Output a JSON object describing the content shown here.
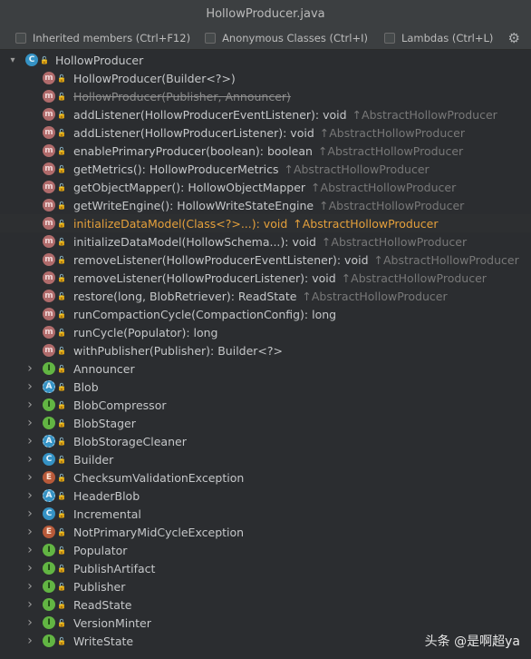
{
  "window": {
    "title": "HollowProducer.java"
  },
  "filters": {
    "inherited": "Inherited members (Ctrl+F12)",
    "anonymous": "Anonymous Classes (Ctrl+I)",
    "lambdas": "Lambdas (Ctrl+L)",
    "settings_icon": "gear-icon"
  },
  "root": {
    "label": "HollowProducer"
  },
  "members": [
    {
      "text": "HollowProducer(Builder<?>)",
      "inherited": "",
      "kind": "m",
      "deprecated": false,
      "selected": false
    },
    {
      "text": "HollowProducer(Publisher, Announcer)",
      "inherited": "",
      "kind": "m",
      "deprecated": true,
      "selected": false
    },
    {
      "text": "addListener(HollowProducerEventListener): void",
      "inherited": "↑AbstractHollowProducer",
      "kind": "m",
      "deprecated": false,
      "selected": false
    },
    {
      "text": "addListener(HollowProducerListener): void",
      "inherited": "↑AbstractHollowProducer",
      "kind": "m",
      "deprecated": false,
      "selected": false
    },
    {
      "text": "enablePrimaryProducer(boolean): boolean",
      "inherited": "↑AbstractHollowProducer",
      "kind": "m",
      "deprecated": false,
      "selected": false
    },
    {
      "text": "getMetrics(): HollowProducerMetrics",
      "inherited": "↑AbstractHollowProducer",
      "kind": "m",
      "deprecated": false,
      "selected": false
    },
    {
      "text": "getObjectMapper(): HollowObjectMapper",
      "inherited": "↑AbstractHollowProducer",
      "kind": "m",
      "deprecated": false,
      "selected": false
    },
    {
      "text": "getWriteEngine(): HollowWriteStateEngine",
      "inherited": "↑AbstractHollowProducer",
      "kind": "m",
      "deprecated": false,
      "selected": false
    },
    {
      "text": "initializeDataModel(Class<?>...): void",
      "inherited": "↑AbstractHollowProducer",
      "kind": "m",
      "deprecated": false,
      "selected": true
    },
    {
      "text": "initializeDataModel(HollowSchema...): void",
      "inherited": "↑AbstractHollowProducer",
      "kind": "m",
      "deprecated": false,
      "selected": false
    },
    {
      "text": "removeListener(HollowProducerEventListener): void",
      "inherited": "↑AbstractHollowProducer",
      "kind": "m",
      "deprecated": false,
      "selected": false
    },
    {
      "text": "removeListener(HollowProducerListener): void",
      "inherited": "↑AbstractHollowProducer",
      "kind": "m",
      "deprecated": false,
      "selected": false
    },
    {
      "text": "restore(long, BlobRetriever): ReadState",
      "inherited": "↑AbstractHollowProducer",
      "kind": "m",
      "deprecated": false,
      "selected": false
    },
    {
      "text": "runCompactionCycle(CompactionConfig): long",
      "inherited": "",
      "kind": "m",
      "deprecated": false,
      "selected": false
    },
    {
      "text": "runCycle(Populator): long",
      "inherited": "",
      "kind": "m",
      "deprecated": false,
      "selected": false
    },
    {
      "text": "withPublisher(Publisher): Builder<?>",
      "inherited": "",
      "kind": "m",
      "deprecated": false,
      "selected": false
    }
  ],
  "nested": [
    {
      "text": "Announcer",
      "kind": "i"
    },
    {
      "text": "Blob",
      "kind": "a"
    },
    {
      "text": "BlobCompressor",
      "kind": "i"
    },
    {
      "text": "BlobStager",
      "kind": "i"
    },
    {
      "text": "BlobStorageCleaner",
      "kind": "a"
    },
    {
      "text": "Builder",
      "kind": "c"
    },
    {
      "text": "ChecksumValidationException",
      "kind": "ex"
    },
    {
      "text": "HeaderBlob",
      "kind": "a"
    },
    {
      "text": "Incremental",
      "kind": "c"
    },
    {
      "text": "NotPrimaryMidCycleException",
      "kind": "ex"
    },
    {
      "text": "Populator",
      "kind": "i"
    },
    {
      "text": "PublishArtifact",
      "kind": "i"
    },
    {
      "text": "Publisher",
      "kind": "i"
    },
    {
      "text": "ReadState",
      "kind": "i"
    },
    {
      "text": "VersionMinter",
      "kind": "i"
    },
    {
      "text": "WriteState",
      "kind": "i"
    }
  ],
  "watermark": "头条 @是啊超ya",
  "colors": {
    "selected": "#e5a03b",
    "inherited": "#787878"
  }
}
